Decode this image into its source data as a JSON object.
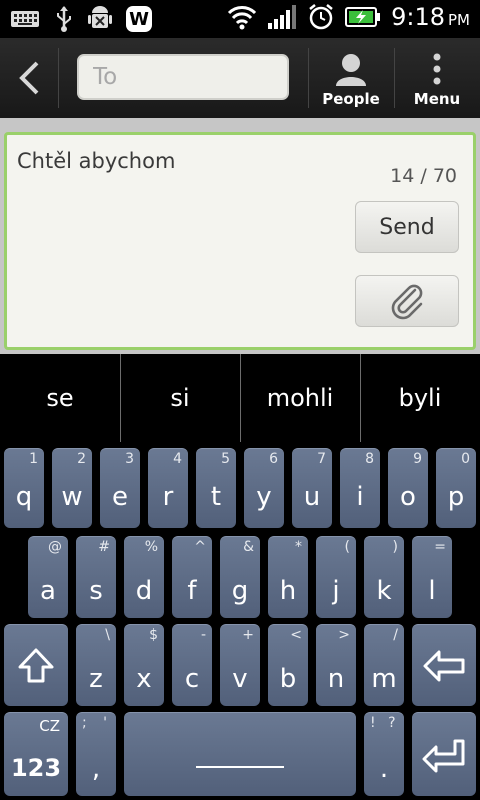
{
  "status_bar": {
    "time": "9:18",
    "ampm": "PM",
    "notification_app_letter": "W"
  },
  "header": {
    "to_placeholder": "To",
    "people_label": "People",
    "menu_label": "Menu"
  },
  "compose": {
    "message_text": "Chtěl abychom",
    "char_count": "14 / 70",
    "send_label": "Send"
  },
  "suggestions": [
    "se",
    "si",
    "mohli",
    "byli"
  ],
  "keyboard": {
    "row1": [
      {
        "key": "q",
        "hint": "1"
      },
      {
        "key": "w",
        "hint": "2"
      },
      {
        "key": "e",
        "hint": "3"
      },
      {
        "key": "r",
        "hint": "4"
      },
      {
        "key": "t",
        "hint": "5"
      },
      {
        "key": "y",
        "hint": "6"
      },
      {
        "key": "u",
        "hint": "7"
      },
      {
        "key": "i",
        "hint": "8"
      },
      {
        "key": "o",
        "hint": "9"
      },
      {
        "key": "p",
        "hint": "0"
      }
    ],
    "row2": [
      {
        "key": "a",
        "hint": "@"
      },
      {
        "key": "s",
        "hint": "#"
      },
      {
        "key": "d",
        "hint": "%"
      },
      {
        "key": "f",
        "hint": "^"
      },
      {
        "key": "g",
        "hint": "&"
      },
      {
        "key": "h",
        "hint": "*"
      },
      {
        "key": "j",
        "hint": "("
      },
      {
        "key": "k",
        "hint": ")"
      },
      {
        "key": "l",
        "hint": "="
      }
    ],
    "row3": [
      {
        "key": "z",
        "hint": "\\"
      },
      {
        "key": "x",
        "hint": "$"
      },
      {
        "key": "c",
        "hint": "-"
      },
      {
        "key": "v",
        "hint": "+"
      },
      {
        "key": "b",
        "hint": "<"
      },
      {
        "key": "n",
        "hint": ">"
      },
      {
        "key": "m",
        "hint": "/"
      }
    ],
    "lang_label": "CZ",
    "num_label": "123",
    "comma_hint": "; '",
    "comma_key": ",",
    "period_hint": "! ?",
    "period_key": "."
  },
  "colors": {
    "key_bg": "#5f6d87",
    "compose_border": "#9ad06a",
    "accent": "#ffffff"
  }
}
